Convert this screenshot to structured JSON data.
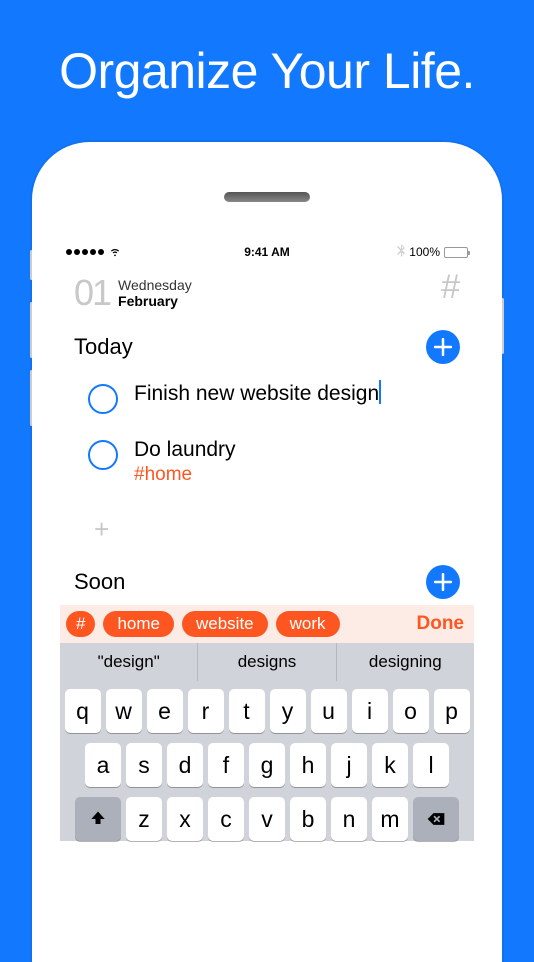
{
  "hero": {
    "title": "Organize Your Life."
  },
  "status": {
    "time": "9:41 AM",
    "battery_pct": "100%"
  },
  "date": {
    "num": "01",
    "day": "Wednesday",
    "month": "February"
  },
  "hash": "#",
  "sections": {
    "today": "Today",
    "soon": "Soon"
  },
  "tasks": [
    {
      "text": "Finish new website design",
      "tag": "",
      "editing": true
    },
    {
      "text": "Do laundry",
      "tag": "#home",
      "editing": false
    }
  ],
  "add_glyph": "+",
  "tags_bar": {
    "hash": "#",
    "items": [
      "home",
      "website",
      "work"
    ],
    "done": "Done"
  },
  "suggestions": [
    "\"design\"",
    "designs",
    "designing"
  ],
  "keyboard": {
    "row1": [
      "q",
      "w",
      "e",
      "r",
      "t",
      "y",
      "u",
      "i",
      "o",
      "p"
    ],
    "row2": [
      "a",
      "s",
      "d",
      "f",
      "g",
      "h",
      "j",
      "k",
      "l"
    ],
    "row3": [
      "z",
      "x",
      "c",
      "v",
      "b",
      "n",
      "m"
    ]
  }
}
